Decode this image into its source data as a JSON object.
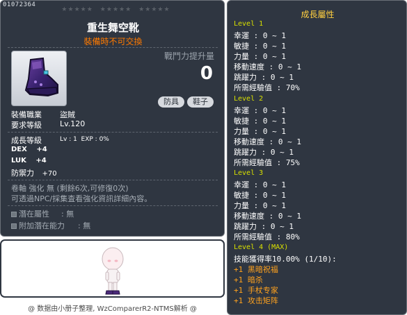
{
  "item": {
    "id": "01072364",
    "name": "重生舞空靴",
    "trade": "裝備時不可交換",
    "power_label": "戰鬥力提升量",
    "power_value": "0",
    "category_chips": [
      "防具",
      "鞋子"
    ]
  },
  "requirements": {
    "job_label": "裝備職業",
    "job_value": "盜賊",
    "level_label": "要求等級",
    "level_value": "Lv.120"
  },
  "growth_info": {
    "label": "成長等級",
    "value": "Lv : 1  EXP : 0%"
  },
  "stats": [
    {
      "label": "DEX",
      "value": "+4"
    },
    {
      "label": "LUK",
      "value": "+4"
    },
    {
      "label": "防禦力",
      "value": "+70"
    }
  ],
  "scroll_line": "卷軸 強化 無 (剩餘6次,可修復0次)",
  "enhance_note": "可透過NPC/採集査看強化資訊詳細內容。",
  "potentials": [
    {
      "label": "潛在屬性",
      "value": ": 無"
    },
    {
      "label": "附加潛在能力",
      "value": ": 無"
    }
  ],
  "footer": "@ 数据由小册子整理, WzComparerR2-NTMS解析 @",
  "growth_panel": {
    "title": "成長屬性",
    "levels": [
      {
        "header": "Level 1",
        "lines": [
          "幸運 : 0 ~ 1",
          "敏捷 : 0 ~ 1",
          "力量 : 0 ~ 1",
          "移動速度 : 0 ~ 1",
          "跳躍力 : 0 ~ 1",
          "所需經驗值 : 70%"
        ]
      },
      {
        "header": "Level 2",
        "lines": [
          "幸運 : 0 ~ 1",
          "敏捷 : 0 ~ 1",
          "力量 : 0 ~ 1",
          "移動速度 : 0 ~ 1",
          "跳躍力 : 0 ~ 1",
          "所需經驗值 : 75%"
        ]
      },
      {
        "header": "Level 3",
        "lines": [
          "幸運 : 0 ~ 1",
          "敏捷 : 0 ~ 1",
          "力量 : 0 ~ 1",
          "移動速度 : 0 ~ 1",
          "跳躍力 : 0 ~ 1",
          "所需經驗值 : 80%"
        ]
      }
    ],
    "level4": {
      "header": "Level 4 (MAX)",
      "skill_line": "技能獲得率10.00% (1/10):",
      "bonuses": [
        "+1 黑暗祝福",
        "+1 暗杀",
        "+1 手杖专家",
        "+1 攻击矩阵"
      ]
    }
  },
  "colors": {
    "panel_bg": "#2f3641",
    "trade_orange": "#ff7a00",
    "growth_title": "#ffcf40",
    "level_header": "#d8e000",
    "bonus_orange": "#ffa21e"
  },
  "icons": {
    "item_icon": "purple-boot-icon",
    "avatar": "chibi-character-avatar",
    "star": "star-icon"
  }
}
